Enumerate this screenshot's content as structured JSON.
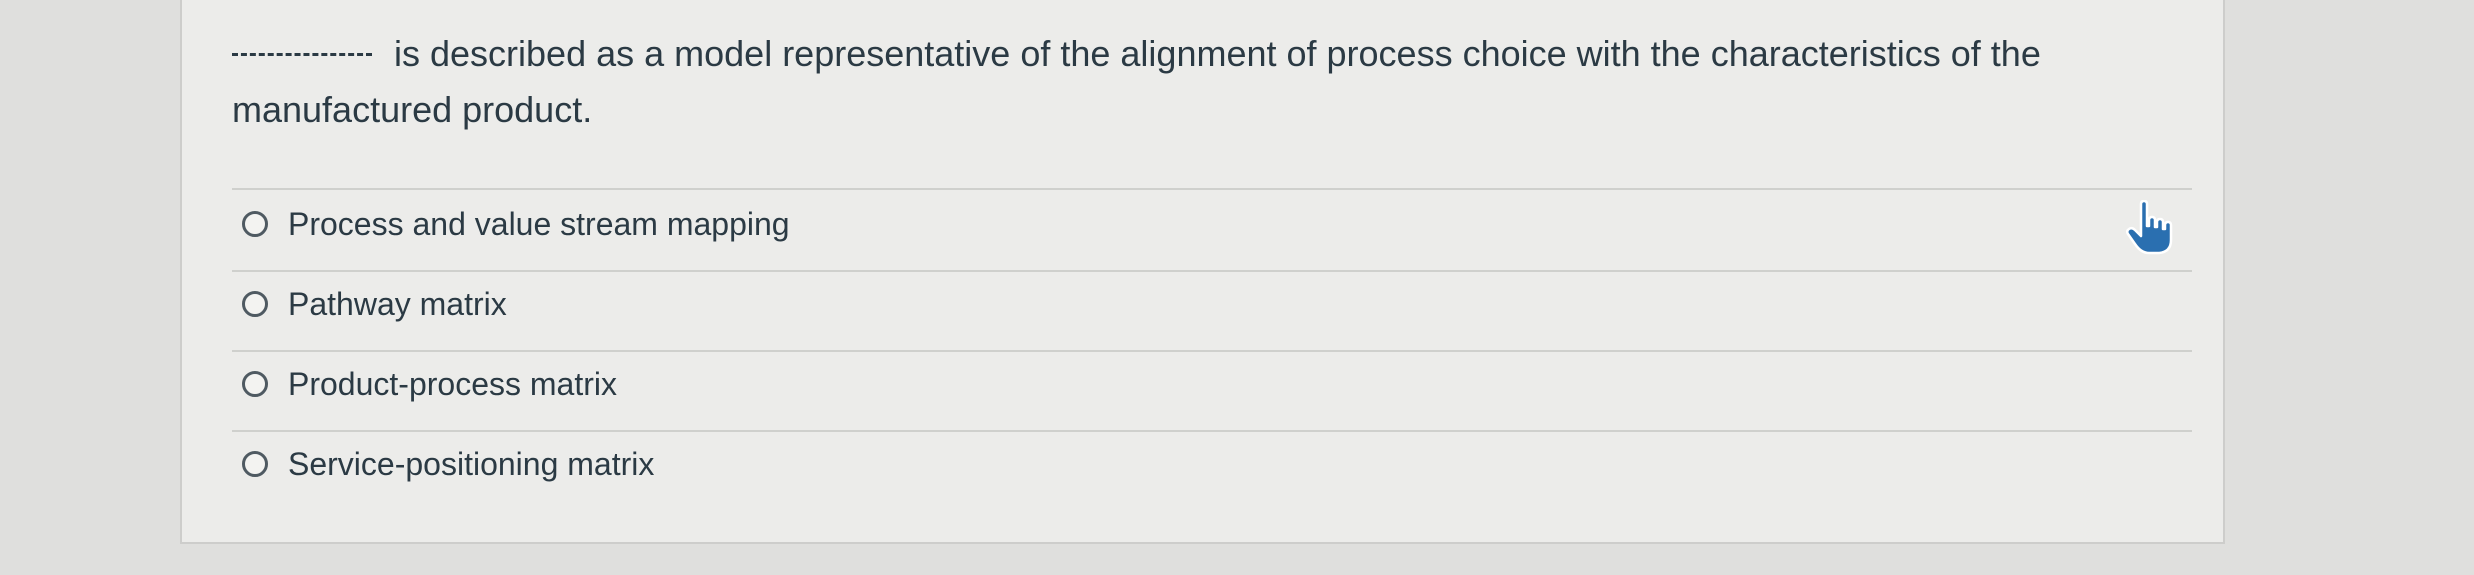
{
  "question": {
    "blank": "_________",
    "text": "is described as a model representative of the alignment of process choice with the characteristics of the manufactured product."
  },
  "answers": [
    {
      "label": "Process and value stream mapping",
      "selected": false
    },
    {
      "label": "Pathway matrix",
      "selected": false
    },
    {
      "label": "Product-process matrix",
      "selected": false
    },
    {
      "label": "Service-positioning matrix",
      "selected": false
    }
  ],
  "icons": {
    "cursor": "hand-pointer-icon",
    "radio": "radio-button-icon"
  },
  "colors": {
    "page_background": "#dfdfdd",
    "card_background": "#ececea",
    "text": "#2b3a44",
    "cursor": "#2a6fb0"
  }
}
